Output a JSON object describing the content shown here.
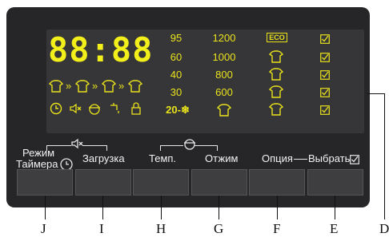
{
  "display": {
    "time": "88:88",
    "temperatures": [
      "95",
      "60",
      "40",
      "30",
      "20-❄"
    ],
    "spins": [
      "1200",
      "1000",
      "800",
      "600"
    ],
    "eco_label": "ECO",
    "arrow": "»"
  },
  "controls": {
    "timer_label_line1": "Режим",
    "timer_label_line2": "Таймера",
    "load_label": "Загрузка",
    "temp_label": "Темп.",
    "spin_label": "Отжим",
    "option_label": "Опция",
    "select_label": "Выбрать"
  },
  "callouts": [
    "J",
    "I",
    "H",
    "G",
    "F",
    "E",
    "D"
  ],
  "colors": {
    "panel": "#262628",
    "display": "#363638",
    "segment": "#f3ef1a",
    "label": "#f2f2f2"
  }
}
